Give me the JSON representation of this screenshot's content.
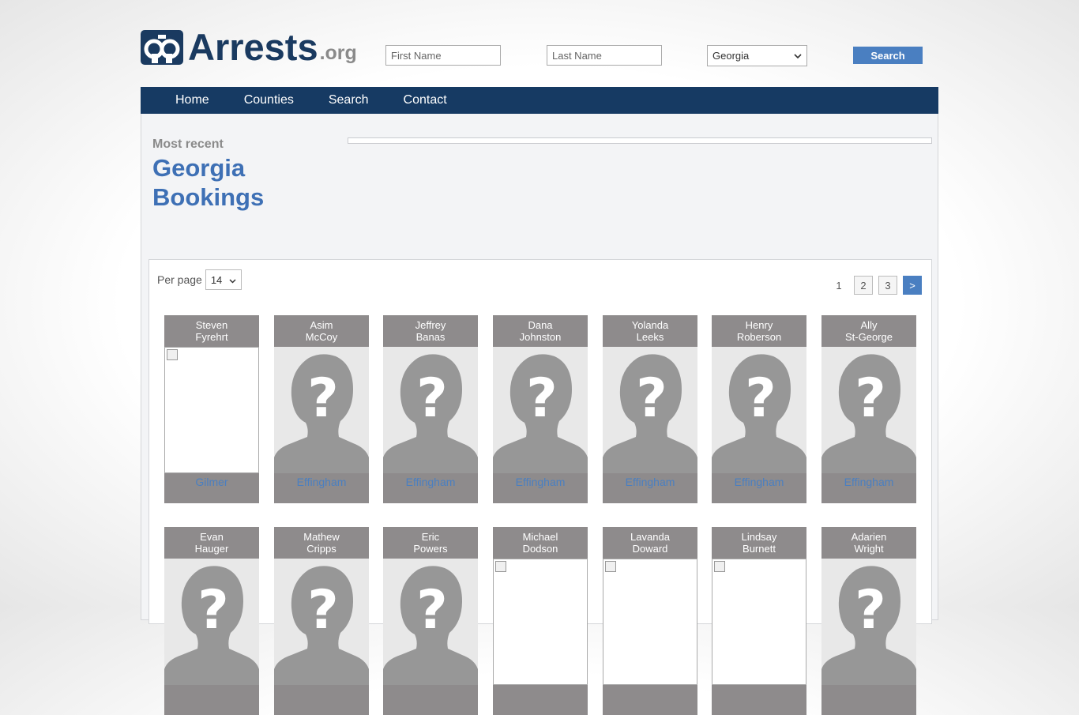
{
  "logo": {
    "name": "Arrests",
    "tld": ".org"
  },
  "search": {
    "first_placeholder": "First Name",
    "last_placeholder": "Last Name",
    "state": "Georgia",
    "button": "Search"
  },
  "nav": [
    "Home",
    "Counties",
    "Search",
    "Contact"
  ],
  "header": {
    "kicker": "Most recent",
    "title": "Georgia Bookings"
  },
  "list": {
    "per_page_label": "Per page",
    "per_page_value": "14",
    "pages": [
      "1",
      "2",
      "3"
    ],
    "next": ">"
  },
  "bookings": [
    {
      "first": "Steven",
      "last": "Fyrehrt",
      "county": "Gilmer",
      "photo": "broken"
    },
    {
      "first": "Asim",
      "last": "McCoy",
      "county": "Effingham",
      "photo": "placeholder"
    },
    {
      "first": "Jeffrey",
      "last": "Banas",
      "county": "Effingham",
      "photo": "placeholder"
    },
    {
      "first": "Dana",
      "last": "Johnston",
      "county": "Effingham",
      "photo": "placeholder"
    },
    {
      "first": "Yolanda",
      "last": "Leeks",
      "county": "Effingham",
      "photo": "placeholder"
    },
    {
      "first": "Henry",
      "last": "Roberson",
      "county": "Effingham",
      "photo": "placeholder"
    },
    {
      "first": "Ally",
      "last": "St-George",
      "county": "Effingham",
      "photo": "placeholder"
    },
    {
      "first": "Evan",
      "last": "Hauger",
      "county": "",
      "photo": "placeholder"
    },
    {
      "first": "Mathew",
      "last": "Cripps",
      "county": "",
      "photo": "placeholder"
    },
    {
      "first": "Eric",
      "last": "Powers",
      "county": "",
      "photo": "placeholder"
    },
    {
      "first": "Michael",
      "last": "Dodson",
      "county": "",
      "photo": "broken"
    },
    {
      "first": "Lavanda",
      "last": "Doward",
      "county": "",
      "photo": "broken"
    },
    {
      "first": "Lindsay",
      "last": "Burnett",
      "county": "",
      "photo": "broken"
    },
    {
      "first": "Adarien",
      "last": "Wright",
      "county": "",
      "photo": "placeholder"
    }
  ]
}
